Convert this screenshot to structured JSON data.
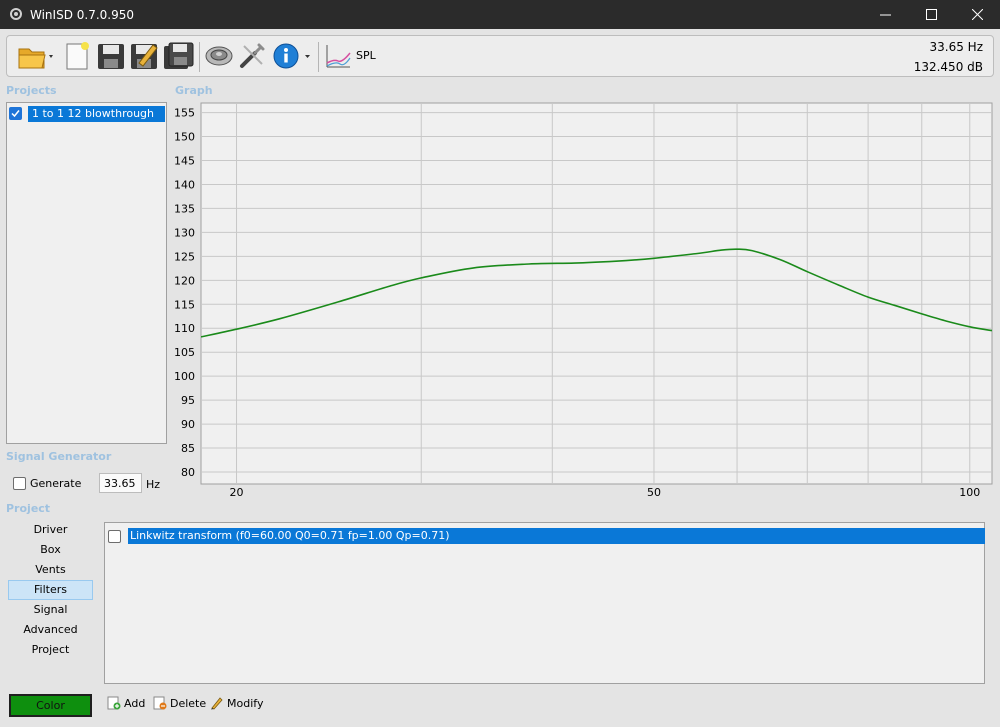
{
  "window": {
    "title": "WinISD 0.7.0.950",
    "minimize_icon": "minimize-icon",
    "maximize_icon": "maximize-icon",
    "close_icon": "close-icon"
  },
  "toolbar": {
    "spl_label": "SPL",
    "readout_freq": "33.65 Hz",
    "readout_db": "132.450 dB",
    "icons": [
      "open-folder-icon",
      "new-document-icon",
      "save-icon",
      "save-as-icon",
      "save-all-icon",
      "speaker-driver-icon",
      "tools-icon",
      "info-icon",
      "spl-graph-icon"
    ]
  },
  "projects": {
    "label": "Projects",
    "items": [
      {
        "label": "1 to 1 12 blowthrough",
        "checked": true
      }
    ]
  },
  "graph": {
    "label": "Graph"
  },
  "chart_data": {
    "type": "line",
    "xscale": "log",
    "xlim": [
      18.5,
      105
    ],
    "ylim": [
      77.5,
      157
    ],
    "xticks": [
      20,
      50,
      100
    ],
    "yticks": [
      80,
      85,
      90,
      95,
      100,
      105,
      110,
      115,
      120,
      125,
      130,
      135,
      140,
      145,
      150,
      155
    ],
    "x_gridlines": [
      20,
      30,
      40,
      50,
      60,
      70,
      80,
      90,
      100
    ],
    "grid": true,
    "series": [
      {
        "color": "#1a8a1a",
        "x": [
          18.5,
          20,
          22,
          25,
          28,
          30,
          33.65,
          38,
          42,
          46,
          50,
          55,
          58,
          60,
          62,
          66,
          70,
          75,
          80,
          85,
          90,
          95,
          100,
          105
        ],
        "y": [
          108.2,
          109.8,
          112.0,
          115.5,
          118.8,
          120.5,
          122.6,
          123.4,
          123.6,
          124.0,
          124.6,
          125.6,
          126.3,
          126.5,
          126.2,
          124.3,
          121.8,
          119.0,
          116.5,
          114.7,
          113.0,
          111.5,
          110.3,
          109.5
        ]
      }
    ]
  },
  "signal_generator": {
    "label": "Signal Generator",
    "generate_label": "Generate",
    "generate_checked": false,
    "freq_value": "33.65",
    "freq_unit": "Hz"
  },
  "project_nav": {
    "label": "Project",
    "items": [
      "Driver",
      "Box",
      "Vents",
      "Filters",
      "Signal",
      "Advanced",
      "Project"
    ],
    "active": "Filters"
  },
  "filters": {
    "items": [
      {
        "label": "Linkwitz transform (f0=60.00 Q0=0.71 fp=1.00 Qp=0.71)",
        "checked": false
      }
    ],
    "add_label": "Add",
    "delete_label": "Delete",
    "modify_label": "Modify"
  },
  "color_button": {
    "label": "Color",
    "color": "#0e8f0e"
  }
}
